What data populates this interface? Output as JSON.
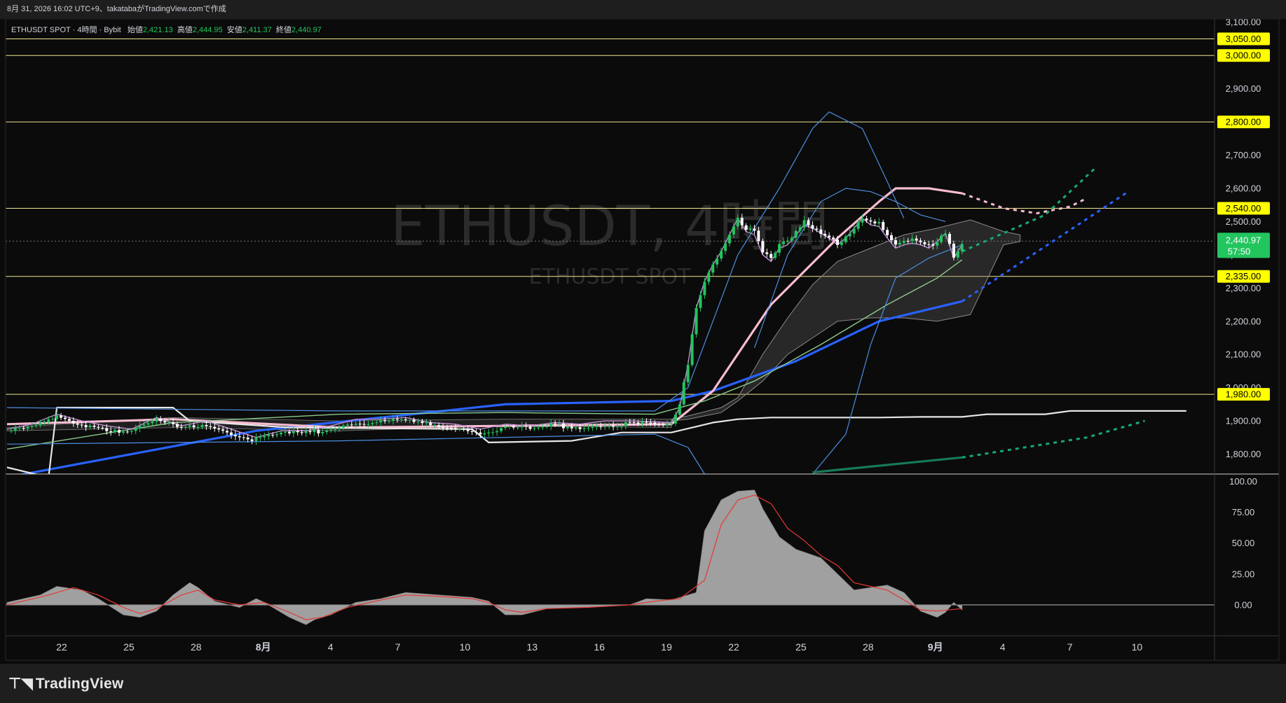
{
  "header": {
    "caption": "8月 31, 2026 16:02 UTC+9、takatabaがTradingView.comで作成"
  },
  "legend": {
    "symbol": "ETHUSDT SPOT · 4時間 · Bybit",
    "open_label": "始値",
    "open": "2,421.13",
    "high_label": "高値",
    "high": "2,444.95",
    "low_label": "安値",
    "low": "2,411.37",
    "close_label": "終値",
    "close": "2,440.97"
  },
  "watermark": {
    "title": "ETHUSDT, 4時間",
    "subtitle": "ETHUSDT SPOT"
  },
  "price_badge": {
    "price": "2,440.97",
    "countdown": "57:50"
  },
  "footer": {
    "brand": "TradingView"
  },
  "colors": {
    "background": "#0b0b0b",
    "up": "#22c55e",
    "down": "#ffffff",
    "level_line": "#f0e68c",
    "level_tag": "#ffff00",
    "blue_ma": "#2962ff",
    "pink_ma": "#f8bbd0",
    "white_line": "#e6e6e6",
    "bb": "#4c8ee0",
    "green_ma": "#8bc98b",
    "teal_line": "#18a872",
    "osc_fill": "#a0a0a0",
    "osc_signal": "#e53935"
  },
  "chart_data": [
    {
      "type": "line",
      "title": "",
      "x_axis_labels": [
        "22",
        "25",
        "28",
        "8月",
        "4",
        "7",
        "10",
        "13",
        "16",
        "19",
        "22",
        "25",
        "28",
        "9月",
        "4",
        "7",
        "10"
      ],
      "y_ticks": [
        "3,100.00",
        "3,050.00",
        "3,000.00",
        "2,900.00",
        "2,800.00",
        "2,700.00",
        "2,600.00",
        "2,540.00",
        "2,500.00",
        "2,400.00",
        "2,335.00",
        "2,300.00",
        "2,200.00",
        "2,100.00",
        "2,000.00",
        "1,980.00",
        "1,900.00",
        "1,800.00"
      ],
      "ylim": [
        1740,
        3110
      ],
      "horizontal_levels": [
        {
          "label": "3,050.00",
          "value": 3050
        },
        {
          "label": "3,000.00",
          "value": 3000
        },
        {
          "label": "2,800.00",
          "value": 2800
        },
        {
          "label": "2,540.00",
          "value": 2540
        },
        {
          "label": "2,335.00",
          "value": 2335
        },
        {
          "label": "1,980.00",
          "value": 1980
        }
      ],
      "price_path": [
        [
          0,
          1870
        ],
        [
          3,
          1885
        ],
        [
          6,
          1915
        ],
        [
          9,
          1895
        ],
        [
          12,
          1880
        ],
        [
          15,
          1870
        ],
        [
          18,
          1905
        ],
        [
          21,
          1880
        ],
        [
          24,
          1895
        ],
        [
          27,
          1870
        ],
        [
          30,
          1845
        ],
        [
          33,
          1865
        ],
        [
          36,
          1865
        ],
        [
          39,
          1880
        ],
        [
          42,
          1900
        ],
        [
          45,
          1900
        ],
        [
          48,
          1905
        ],
        [
          51,
          1890
        ],
        [
          54,
          1885
        ],
        [
          57,
          1870
        ],
        [
          60,
          1885
        ],
        [
          63,
          1880
        ],
        [
          66,
          1890
        ],
        [
          69,
          1885
        ],
        [
          72,
          1895
        ],
        [
          75,
          1895
        ],
        [
          78,
          1892
        ],
        [
          80,
          1890
        ],
        [
          81,
          1950
        ],
        [
          82,
          2080
        ],
        [
          83,
          2250
        ],
        [
          84,
          2330
        ],
        [
          85,
          2380
        ],
        [
          86,
          2420
        ],
        [
          87,
          2470
        ],
        [
          88,
          2520
        ],
        [
          89,
          2480
        ],
        [
          90,
          2470
        ],
        [
          91,
          2410
        ],
        [
          92,
          2390
        ],
        [
          93,
          2430
        ],
        [
          94,
          2440
        ],
        [
          95,
          2470
        ],
        [
          96,
          2500
        ],
        [
          97,
          2490
        ],
        [
          98,
          2475
        ],
        [
          99,
          2460
        ],
        [
          100,
          2440
        ],
        [
          101,
          2460
        ],
        [
          102,
          2490
        ],
        [
          103,
          2520
        ],
        [
          104,
          2500
        ],
        [
          105,
          2495
        ],
        [
          106,
          2460
        ],
        [
          107,
          2430
        ],
        [
          108,
          2440
        ],
        [
          109,
          2445
        ],
        [
          110,
          2440
        ],
        [
          111,
          2430
        ],
        [
          112,
          2450
        ],
        [
          113,
          2475
        ],
        [
          114,
          2400
        ],
        [
          115,
          2441
        ]
      ],
      "series": [
        {
          "name": "",
          "kind": "blue-ma",
          "values": [
            [
              0,
              1730
            ],
            [
              30,
              1870
            ],
            [
              60,
              1950
            ],
            [
              80,
              1960
            ],
            [
              85,
              1990
            ],
            [
              95,
              2080
            ],
            [
              105,
              2200
            ],
            [
              115,
              2260
            ]
          ],
          "projection": [
            [
              115,
              2260
            ],
            [
              135,
              2590
            ]
          ]
        },
        {
          "name": "",
          "kind": "pink-ma",
          "values": [
            [
              0,
              1890
            ],
            [
              20,
              1905
            ],
            [
              40,
              1880
            ],
            [
              60,
              1885
            ],
            [
              80,
              1890
            ],
            [
              85,
              1990
            ],
            [
              92,
              2250
            ],
            [
              100,
              2450
            ],
            [
              105,
              2560
            ],
            [
              107,
              2600
            ],
            [
              111,
              2600
            ],
            [
              115,
              2585
            ]
          ],
          "projection": [
            [
              115,
              2585
            ],
            [
              120,
              2540
            ],
            [
              124,
              2525
            ],
            [
              128,
              2545
            ],
            [
              130,
              2570
            ]
          ]
        },
        {
          "name": "",
          "kind": "white-step",
          "values": [
            [
              0,
              1760
            ],
            [
              5,
              1730
            ],
            [
              6,
              1940
            ],
            [
              20,
              1940
            ],
            [
              22,
              1900
            ],
            [
              34,
              1880
            ],
            [
              56,
              1875
            ],
            [
              58,
              1835
            ],
            [
              68,
              1840
            ],
            [
              74,
              1865
            ],
            [
              80,
              1865
            ],
            [
              85,
              1895
            ],
            [
              88,
              1905
            ],
            [
              92,
              1910
            ],
            [
              100,
              1910
            ],
            [
              105,
              1910
            ],
            [
              110,
              1912
            ],
            [
              115,
              1912
            ],
            [
              118,
              1920
            ],
            [
              125,
              1920
            ],
            [
              128,
              1930
            ],
            [
              135,
              1930
            ],
            [
              142,
              1930
            ]
          ]
        },
        {
          "name": "",
          "kind": "green-ma",
          "values": [
            [
              0,
              1815
            ],
            [
              20,
              1895
            ],
            [
              40,
              1920
            ],
            [
              60,
              1925
            ],
            [
              78,
              1920
            ],
            [
              84,
              1960
            ],
            [
              90,
              2020
            ],
            [
              98,
              2130
            ],
            [
              106,
              2250
            ],
            [
              112,
              2330
            ],
            [
              115,
              2385
            ]
          ]
        },
        {
          "name": "",
          "kind": "bb-upper",
          "values": [
            [
              0,
              1940
            ],
            [
              40,
              1930
            ],
            [
              78,
              1930
            ],
            [
              82,
              2000
            ],
            [
              88,
              2400
            ],
            [
              93,
              2600
            ],
            [
              97,
              2780
            ],
            [
              99,
              2830
            ],
            [
              103,
              2780
            ],
            [
              106,
              2620
            ],
            [
              108,
              2510
            ]
          ]
        },
        {
          "name": "",
          "kind": "bb-lower",
          "values": [
            [
              0,
              1830
            ],
            [
              40,
              1840
            ],
            [
              78,
              1860
            ],
            [
              82,
              1820
            ],
            [
              84,
              1740
            ]
          ]
        },
        {
          "name": "",
          "kind": "bb-lower-2",
          "values": [
            [
              97,
              1740
            ],
            [
              101,
              1860
            ],
            [
              104,
              2130
            ],
            [
              107,
              2330
            ],
            [
              111,
              2390
            ],
            [
              115,
              2430
            ]
          ]
        },
        {
          "name": "",
          "kind": "teal-line",
          "values": [
            [
              97,
              1745
            ],
            [
              115,
              1790
            ]
          ],
          "projection": [
            [
              115,
              1790
            ],
            [
              130,
              1850
            ],
            [
              137,
              1900
            ]
          ]
        },
        {
          "name": "",
          "kind": "teal-projection",
          "values": [
            [
              115,
              2410
            ],
            [
              125,
              2520
            ],
            [
              131,
              2660
            ]
          ]
        }
      ]
    },
    {
      "type": "area",
      "title": "",
      "y_ticks": [
        "100.00",
        "75.00",
        "50.00",
        "25.00",
        "0.00"
      ],
      "ylim": [
        -25,
        106
      ],
      "x_range": [
        0,
        115
      ],
      "values": [
        [
          0,
          2
        ],
        [
          4,
          8
        ],
        [
          6,
          15
        ],
        [
          9,
          12
        ],
        [
          11,
          5
        ],
        [
          14,
          -8
        ],
        [
          16,
          -10
        ],
        [
          18,
          -5
        ],
        [
          20,
          8
        ],
        [
          22,
          18
        ],
        [
          23,
          14
        ],
        [
          25,
          3
        ],
        [
          28,
          -2
        ],
        [
          30,
          5
        ],
        [
          31,
          2
        ],
        [
          34,
          -10
        ],
        [
          36,
          -16
        ],
        [
          37,
          -12
        ],
        [
          39,
          -8
        ],
        [
          42,
          2
        ],
        [
          45,
          5
        ],
        [
          48,
          10
        ],
        [
          52,
          8
        ],
        [
          56,
          6
        ],
        [
          58,
          3
        ],
        [
          60,
          -8
        ],
        [
          62,
          -8
        ],
        [
          65,
          -3
        ],
        [
          70,
          -2
        ],
        [
          75,
          0
        ],
        [
          77,
          5
        ],
        [
          80,
          4
        ],
        [
          83,
          10
        ],
        [
          84,
          60
        ],
        [
          86,
          85
        ],
        [
          88,
          92
        ],
        [
          90,
          93
        ],
        [
          91,
          78
        ],
        [
          93,
          55
        ],
        [
          95,
          45
        ],
        [
          98,
          38
        ],
        [
          100,
          25
        ],
        [
          102,
          12
        ],
        [
          104,
          14
        ],
        [
          106,
          16
        ],
        [
          108,
          10
        ],
        [
          110,
          -5
        ],
        [
          112,
          -10
        ],
        [
          113,
          -6
        ],
        [
          114,
          2
        ],
        [
          115,
          -4
        ]
      ],
      "signal": [
        [
          0,
          0
        ],
        [
          5,
          8
        ],
        [
          8,
          14
        ],
        [
          11,
          8
        ],
        [
          14,
          -2
        ],
        [
          16,
          -7
        ],
        [
          18,
          -3
        ],
        [
          21,
          8
        ],
        [
          23,
          12
        ],
        [
          25,
          4
        ],
        [
          28,
          0
        ],
        [
          31,
          2
        ],
        [
          34,
          -6
        ],
        [
          36,
          -12
        ],
        [
          38,
          -10
        ],
        [
          41,
          -2
        ],
        [
          45,
          4
        ],
        [
          48,
          8
        ],
        [
          52,
          7
        ],
        [
          56,
          5
        ],
        [
          58,
          2
        ],
        [
          60,
          -4
        ],
        [
          62,
          -6
        ],
        [
          65,
          -3
        ],
        [
          70,
          -2
        ],
        [
          75,
          0
        ],
        [
          78,
          3
        ],
        [
          81,
          5
        ],
        [
          84,
          20
        ],
        [
          86,
          65
        ],
        [
          88,
          85
        ],
        [
          90,
          89
        ],
        [
          92,
          82
        ],
        [
          94,
          62
        ],
        [
          96,
          52
        ],
        [
          98,
          40
        ],
        [
          100,
          32
        ],
        [
          102,
          18
        ],
        [
          104,
          15
        ],
        [
          106,
          12
        ],
        [
          108,
          4
        ],
        [
          110,
          -4
        ],
        [
          112,
          -5
        ],
        [
          115,
          -3
        ]
      ]
    }
  ]
}
